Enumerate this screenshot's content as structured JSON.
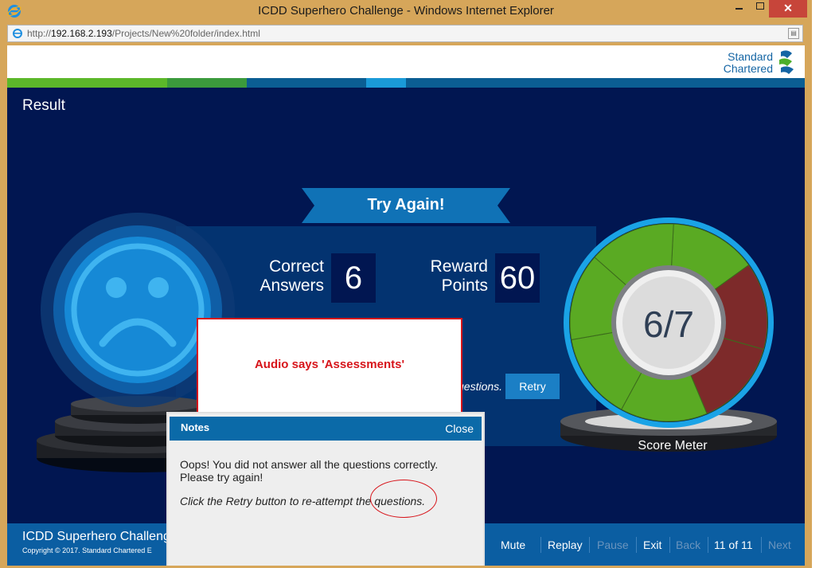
{
  "window": {
    "title": "ICDD Superhero Challenge - Windows Internet Explorer",
    "min_icon": "minimize-icon",
    "max_icon": "maximize-icon",
    "close_label": "✕"
  },
  "address": {
    "url_prefix": "http://",
    "url_host": "192.168.2.193",
    "url_path": "/Projects/New%20folder/index.html"
  },
  "brand": {
    "line1": "Standard",
    "line2": "Chartered",
    "color": "#1465a4"
  },
  "colors": {
    "page_bg": "#011651",
    "panel": "#033370",
    "accent_blue": "#1b7fc5",
    "meter_green": "#5aaa23",
    "meter_red": "#7d2a2a",
    "popup_red": "#d7141a"
  },
  "result": {
    "title": "Result",
    "banner": "Try Again!",
    "correct_label_1": "Correct",
    "correct_label_2": "Answers",
    "correct_value": "6",
    "reward_label_1": "Reward",
    "reward_label_2": "Points",
    "reward_value": "60",
    "questions_fragment": "uestions.",
    "retry_label": "Retry",
    "score": "6/7",
    "score_correct": 6,
    "score_total": 7,
    "meter_label": "Score Meter"
  },
  "popup": {
    "text": "Audio says 'Assessments'"
  },
  "notes": {
    "title": "Notes",
    "close_label": "Close",
    "line1": "Oops! You did not answer all the questions correctly.",
    "line2": "Please try again!",
    "line3": "Click the Retry button to re-attempt the questions."
  },
  "footer": {
    "title": "ICDD Superhero Challeng",
    "copyright": "Copyright © 2017. Standard Chartered E",
    "nav": {
      "mute": "Mute",
      "replay": "Replay",
      "pause": "Pause",
      "exit": "Exit",
      "back": "Back",
      "page": "11 of 11",
      "next": "Next"
    }
  }
}
